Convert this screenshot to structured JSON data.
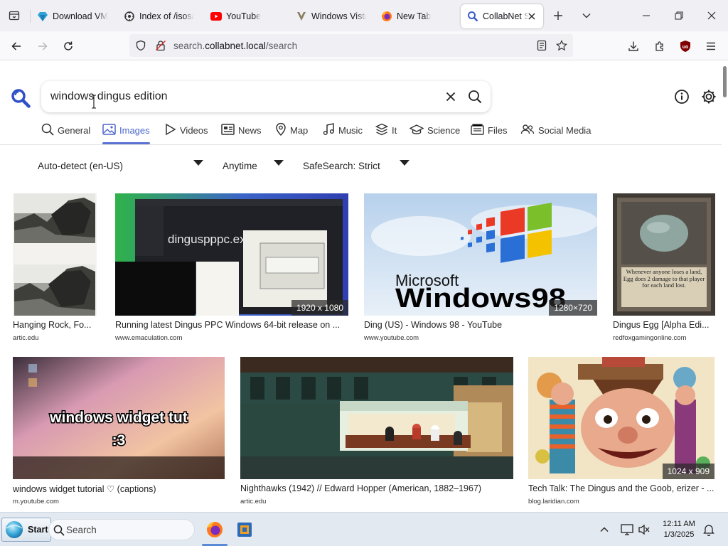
{
  "browser": {
    "tabs": [
      {
        "title": "Download VM",
        "icon": "download-vm-icon",
        "active": false
      },
      {
        "title": "Index of /isos/",
        "icon": "index-icon",
        "active": false
      },
      {
        "title": "YouTube",
        "icon": "youtube-icon",
        "active": false
      },
      {
        "title": "Windows Vista",
        "icon": "windows-vista-icon",
        "active": false
      },
      {
        "title": "New Tab",
        "icon": "firefox-icon",
        "active": false
      },
      {
        "title": "CollabNet S",
        "icon": "search-icon",
        "active": true
      }
    ],
    "url_prefix": "search.",
    "url_domain": "collabnet.local",
    "url_path": "/search"
  },
  "search": {
    "query": "windows dingus edition",
    "categories": [
      {
        "label": "General",
        "icon": "magnifier-icon"
      },
      {
        "label": "Images",
        "icon": "image-icon",
        "active": true
      },
      {
        "label": "Videos",
        "icon": "play-icon"
      },
      {
        "label": "News",
        "icon": "newspaper-icon"
      },
      {
        "label": "Map",
        "icon": "map-pin-icon"
      },
      {
        "label": "Music",
        "icon": "music-icon"
      },
      {
        "label": "It",
        "icon": "layers-icon"
      },
      {
        "label": "Science",
        "icon": "graduation-cap-icon"
      },
      {
        "label": "Files",
        "icon": "files-icon"
      },
      {
        "label": "Social Media",
        "icon": "people-icon"
      }
    ],
    "filters": {
      "language": "Auto-detect (en-US)",
      "time": "Anytime",
      "safesearch": "SafeSearch: Strict"
    }
  },
  "results": [
    {
      "title": "Hanging Rock, Fo...",
      "domain": "artic.edu",
      "resolution": ""
    },
    {
      "title": "Running latest Dingus PPC Windows 64-bit release on ...",
      "domain": "www.emaculation.com",
      "resolution": "1920 x 1080",
      "overlay_text": "dinguspppc.ex"
    },
    {
      "title": "Ding (US) - Windows 98 - YouTube",
      "domain": "www.youtube.com",
      "resolution": "1280×720",
      "overlay_text_1": "Microsoft",
      "overlay_text_2": "Windows98"
    },
    {
      "title": "Dingus Egg [Alpha Edi...",
      "domain": "redfoxgamingonline.com",
      "resolution": "",
      "card_text": "Whenever anyone loses a land, Egg does 2 damage to that player for each land lost."
    },
    {
      "title": "windows widget tutorial ♡ (captions)",
      "domain": "m.youtube.com",
      "resolution": "",
      "overlay_text": "windows widget tut :3"
    },
    {
      "title": "Nighthawks (1942) // Edward Hopper (American, 1882–1967)",
      "domain": "artic.edu",
      "resolution": ""
    },
    {
      "title": "Tech Talk: The Dingus and the Goob, erizer - ...",
      "domain": "blog.laridian.com",
      "resolution": "1024 x 909"
    }
  ],
  "taskbar": {
    "start_label": "Start",
    "search_placeholder": "Search",
    "time": "12:11 AM",
    "date": "1/3/2025"
  },
  "colors": {
    "accent": "#5a73d5",
    "youtube": "#ff0000",
    "ublock": "#800000"
  }
}
